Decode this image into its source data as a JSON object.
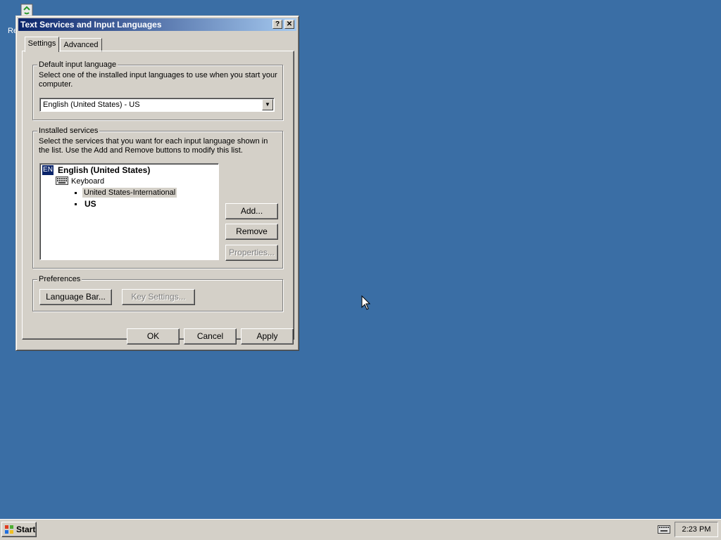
{
  "desktop": {
    "icon_label": "Re"
  },
  "dialog": {
    "title": "Text Services and Input Languages",
    "help_glyph": "?",
    "close_glyph": "✕",
    "tabs": [
      {
        "label": "Settings",
        "active": true
      },
      {
        "label": "Advanced",
        "active": false
      }
    ],
    "default_language": {
      "legend": "Default input language",
      "description": "Select one of the installed input languages to use when you start your computer.",
      "selected": "English (United States) - US"
    },
    "installed_services": {
      "legend": "Installed services",
      "description": "Select the services that you want for each input language shown in the list. Use the Add and Remove buttons to modify this list.",
      "tree": {
        "badge": "EN",
        "language": "English (United States)",
        "category": "Keyboard",
        "layouts": [
          "United States-International",
          "US"
        ],
        "selected_layout": "United States-International"
      },
      "buttons": {
        "add": "Add...",
        "remove": "Remove",
        "properties": "Properties..."
      }
    },
    "preferences": {
      "legend": "Preferences",
      "language_bar": "Language Bar...",
      "key_settings": "Key Settings..."
    },
    "footer": {
      "ok": "OK",
      "cancel": "Cancel",
      "apply": "Apply"
    }
  },
  "taskbar": {
    "start_label": "Start",
    "clock": "2:23 PM"
  },
  "colors": {
    "desktop": "#3a6ea5",
    "titlebar": "#0a246a",
    "face": "#d4d0c8"
  }
}
